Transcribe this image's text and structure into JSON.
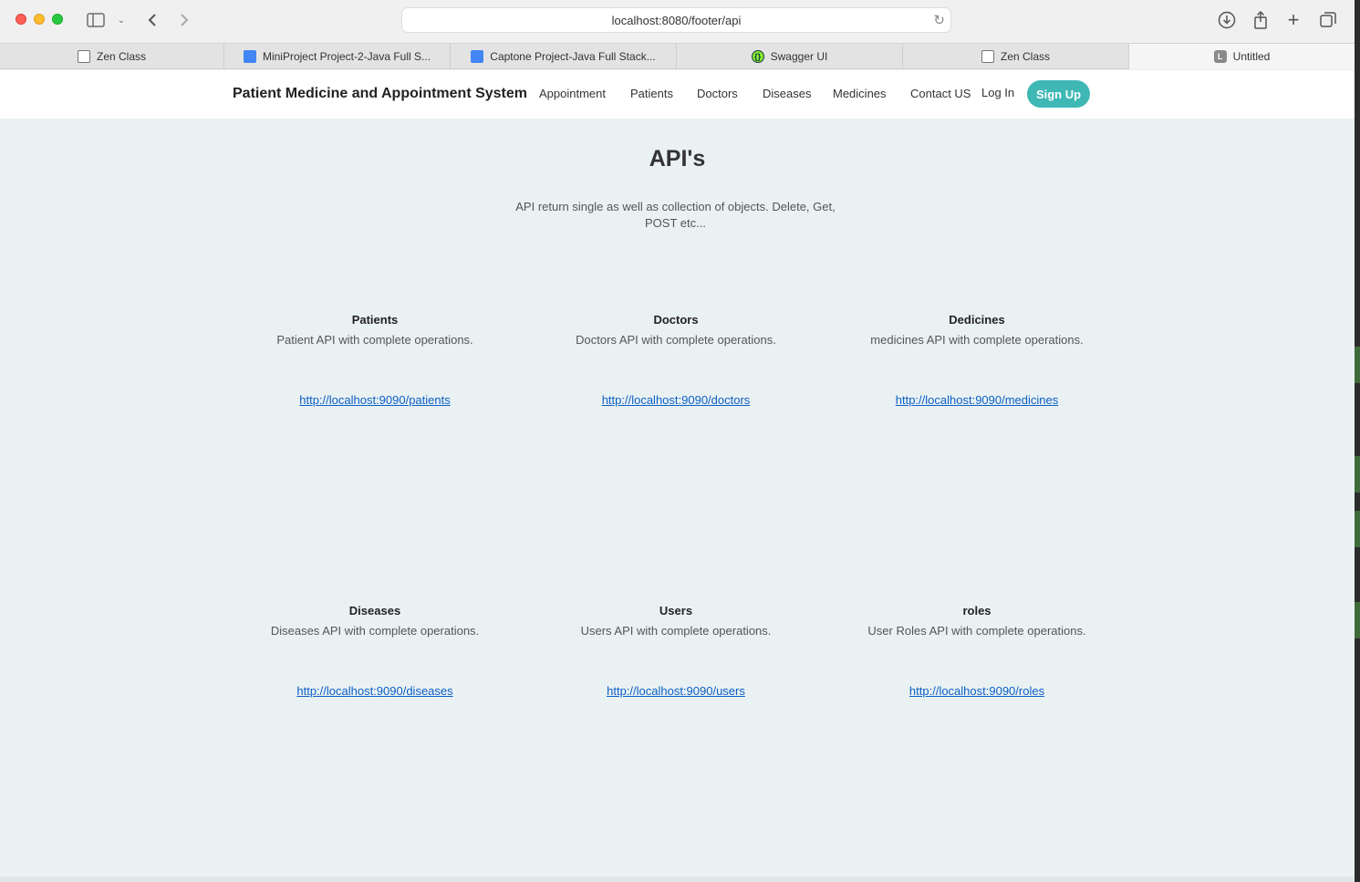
{
  "browser": {
    "url": "localhost:8080/footer/api",
    "tabs": [
      {
        "label": "Zen Class",
        "icon": "window-icon"
      },
      {
        "label": "MiniProject Project-2-Java Full S...",
        "icon": "doc-icon"
      },
      {
        "label": "Captone Project-Java Full Stack...",
        "icon": "doc-icon"
      },
      {
        "label": "Swagger UI",
        "icon": "swagger-icon"
      },
      {
        "label": "Zen Class",
        "icon": "window-icon"
      },
      {
        "label": "Untitled",
        "icon": "letter-icon",
        "icon_letter": "L",
        "active": true
      }
    ]
  },
  "navbar": {
    "brand": "Patient Medicine and Appointment System",
    "links": [
      "Appointment",
      "Patients",
      "Doctors",
      "Diseases",
      "Medicines",
      "Contact US"
    ],
    "login": "Log In",
    "signup": "Sign Up",
    "accent_color": "#3fb8b5"
  },
  "main": {
    "title": "API's",
    "description": "API return single as well as collection of objects. Delete, Get, POST etc...",
    "cards": [
      {
        "title": "Patients",
        "desc": "Patient API with complete operations.",
        "link": "http://localhost:9090/patients"
      },
      {
        "title": "Doctors",
        "desc": "Doctors API with complete operations.",
        "link": "http://localhost:9090/doctors"
      },
      {
        "title": "Dedicines",
        "desc": "medicines API with complete operations.",
        "link": "http://localhost:9090/medicines"
      },
      {
        "title": "Diseases",
        "desc": "Diseases API with complete operations.",
        "link": "http://localhost:9090/diseases"
      },
      {
        "title": "Users",
        "desc": "Users API with complete operations.",
        "link": "http://localhost:9090/users"
      },
      {
        "title": "roles",
        "desc": "User Roles API with complete operations.",
        "link": "http://localhost:9090/roles"
      }
    ]
  }
}
